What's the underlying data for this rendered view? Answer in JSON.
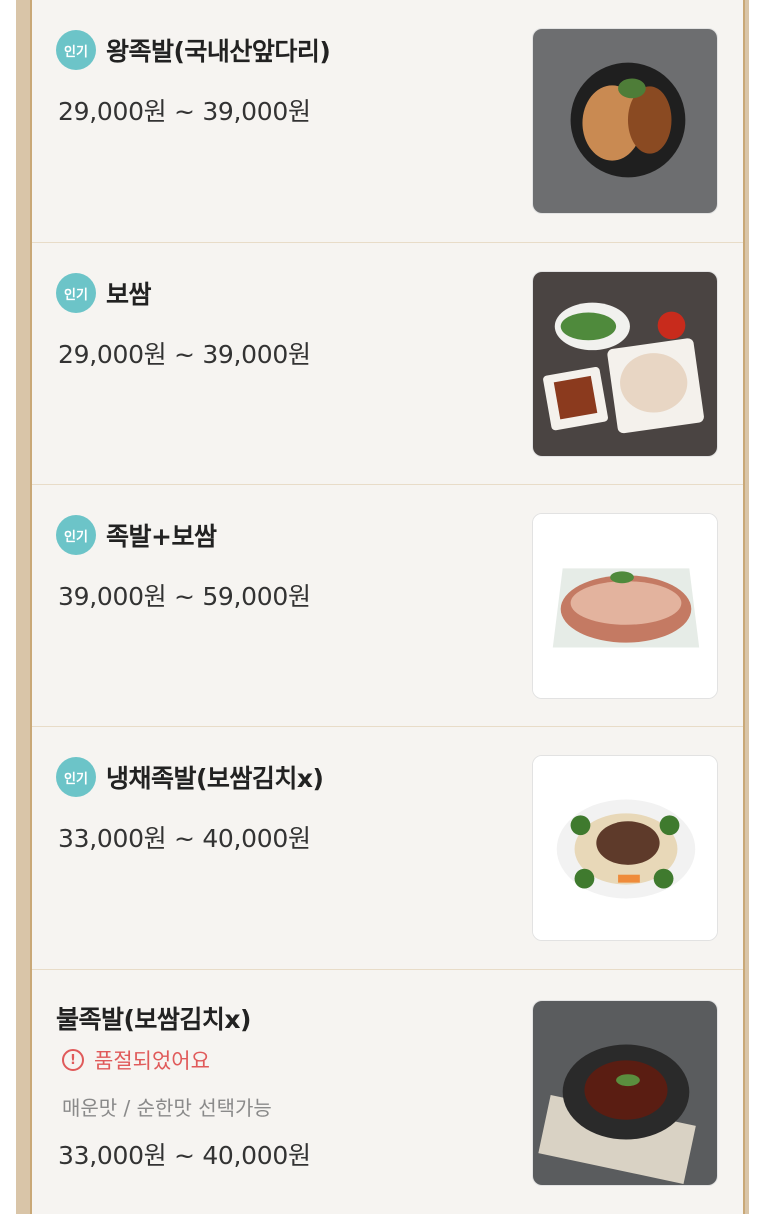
{
  "items": [
    {
      "badge": "인기",
      "name": "왕족발(국내산앞다리)",
      "price": "29,000원 ~ 39,000원"
    },
    {
      "badge": "인기",
      "name": "보쌈",
      "price": "29,000원 ~ 39,000원"
    },
    {
      "badge": "인기",
      "name": "족발+보쌈",
      "price": "39,000원 ~ 59,000원"
    },
    {
      "badge": "인기",
      "name": "냉채족발(보쌈김치x)",
      "price": "33,000원 ~ 40,000원"
    },
    {
      "name": "불족발(보쌈김치x)",
      "status": "품절되었어요",
      "description": "매운맛 / 순한맛 선택가능",
      "price": "33,000원 ~ 40,000원"
    }
  ],
  "colors": {
    "badge": "#6cc4c8",
    "soldout": "#e05a5a",
    "frame": "#c9a877"
  }
}
